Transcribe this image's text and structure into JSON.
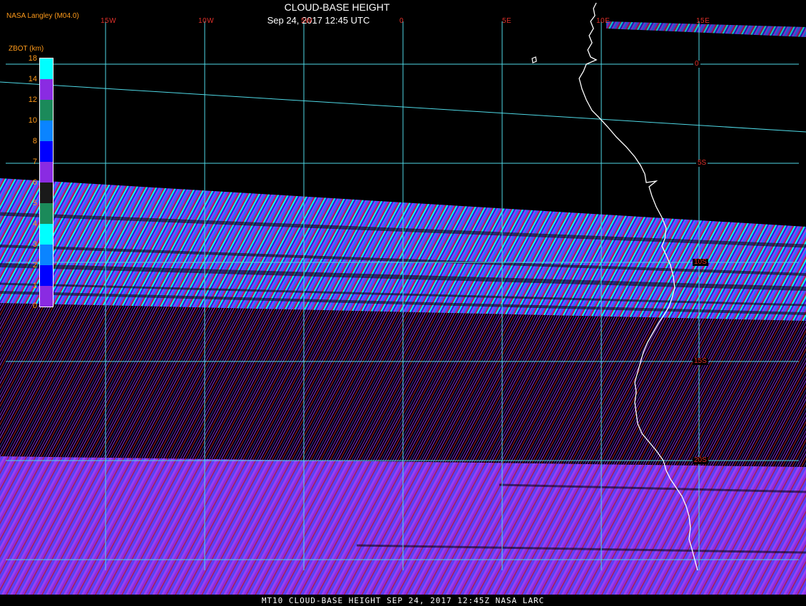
{
  "header": {
    "credit": "NASA Langley (M04.0)",
    "title": "CLOUD-BASE HEIGHT",
    "subtitle": "Sep 24, 2017 12:45 UTC"
  },
  "footer": {
    "caption": "MT10  CLOUD-BASE HEIGHT   SEP 24, 2017 12:45Z   NASA LARC"
  },
  "legend": {
    "title": "ZBOT (km)",
    "tick_labels": [
      "18",
      "14",
      "12",
      "10",
      "8",
      "7",
      "6",
      "5",
      "4",
      "3",
      "2",
      "1",
      "0"
    ],
    "colors_top_to_bottom": [
      "#00ffff",
      "#8a2be2",
      "#1b8a5a",
      "#0a84ff",
      "#0000ff",
      "#8a2be2",
      "#1a1a1a",
      "#1b8a5a",
      "#00ffff",
      "#0a84ff",
      "#0000ff",
      "#8a2be2"
    ]
  },
  "grid": {
    "longitude_labels": [
      "15W",
      "10W",
      "5W",
      "0",
      "5E",
      "10E",
      "15E"
    ],
    "latitude_labels": [
      "0",
      "5S",
      "10S",
      "15S",
      "20S"
    ]
  },
  "colors": {
    "grid_line": "#4fd9e6",
    "label_orange": "#ff9a1a",
    "label_red": "#e0302a",
    "text_white": "#ffffff",
    "coastline": "#ffffff",
    "swath_purple": "#8a2be2",
    "swath_cyan": "#00ffff",
    "swath_blue": "#0000ff",
    "swath_red": "#c0203a"
  },
  "icons": {
    "coastline": "coastline-vector",
    "island": "island-outline"
  }
}
